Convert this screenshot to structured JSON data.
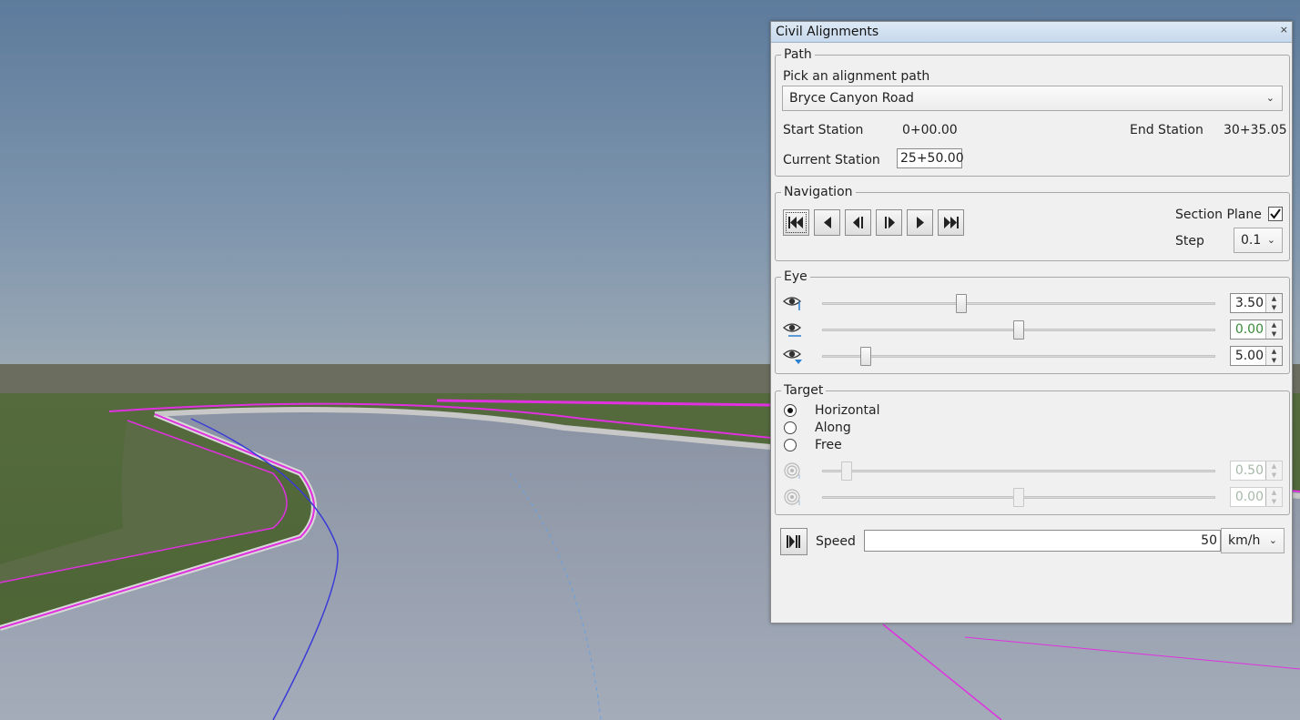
{
  "window": {
    "title": "Civil Alignments",
    "close_glyph": "×"
  },
  "path": {
    "legend": "Path",
    "pick_label": "Pick an alignment path",
    "selected_path": "Bryce Canyon Road",
    "start_station_label": "Start Station",
    "start_station_value": "0+00.00",
    "end_station_label": "End Station",
    "end_station_value": "30+35.05",
    "current_station_label": "Current Station",
    "current_station_value": "25+50.00"
  },
  "navigation": {
    "legend": "Navigation",
    "buttons": [
      "go-to-start",
      "step-back",
      "play-back",
      "play-forward",
      "step-forward",
      "go-to-end"
    ],
    "section_plane_label": "Section Plane",
    "section_plane_checked": true,
    "step_label": "Step",
    "step_value": "0.1"
  },
  "eye": {
    "legend": "Eye",
    "rows": [
      {
        "icon": "eye-height-icon",
        "fraction": 0.35,
        "value": "3.50",
        "value_color": "#222222"
      },
      {
        "icon": "eye-offset-icon",
        "fraction": 0.5,
        "value": "0.00",
        "value_color": "#3a8a3a"
      },
      {
        "icon": "eye-distance-icon",
        "fraction": 0.1,
        "value": "5.00",
        "value_color": "#222222"
      }
    ]
  },
  "target": {
    "legend": "Target",
    "options": [
      "Horizontal",
      "Along",
      "Free"
    ],
    "selected": "Horizontal",
    "rows": [
      {
        "icon": "target-height-icon",
        "fraction": 0.05,
        "value": "0.50"
      },
      {
        "icon": "target-offset-icon",
        "fraction": 0.5,
        "value": "0.00"
      }
    ]
  },
  "playback": {
    "speed_label": "Speed",
    "speed_value": "50",
    "speed_unit": "km/h"
  }
}
